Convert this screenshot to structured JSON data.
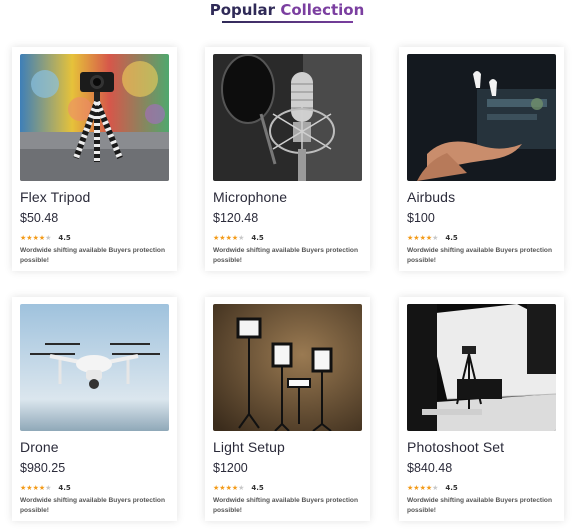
{
  "section": {
    "title_part1": "Popular",
    "title_part2": "Collection"
  },
  "colors": {
    "title_dark": "#2f2a57",
    "title_accent": "#7b3fa0",
    "star": "#f39b1a"
  },
  "products": [
    {
      "name": "Flex Tripod",
      "price": "$50.48",
      "rating": "4.5",
      "description": "Wordwide shifting available Buyers protection possible!",
      "image": "tripod-camera-photo"
    },
    {
      "name": "Microphone",
      "price": "$120.48",
      "rating": "4.5",
      "description": "Wordwide shifting available Buyers protection possible!",
      "image": "studio-microphone-photo"
    },
    {
      "name": "Airbuds",
      "price": "$100",
      "rating": "4.5",
      "description": "Wordwide shifting available Buyers protection possible!",
      "image": "airbuds-hand-photo"
    },
    {
      "name": "Drone",
      "price": "$980.25",
      "rating": "4.5",
      "description": "Wordwide shifting available Buyers protection possible!",
      "image": "drone-photo"
    },
    {
      "name": "Light Setup",
      "price": "$1200",
      "rating": "4.5",
      "description": "Wordwide shifting available Buyers protection possible!",
      "image": "studio-lights-photo"
    },
    {
      "name": "Photoshoot Set",
      "price": "$840.48",
      "rating": "4.5",
      "description": "Wordwide shifting available Buyers protection possible!",
      "image": "photoshoot-set-photo"
    }
  ]
}
